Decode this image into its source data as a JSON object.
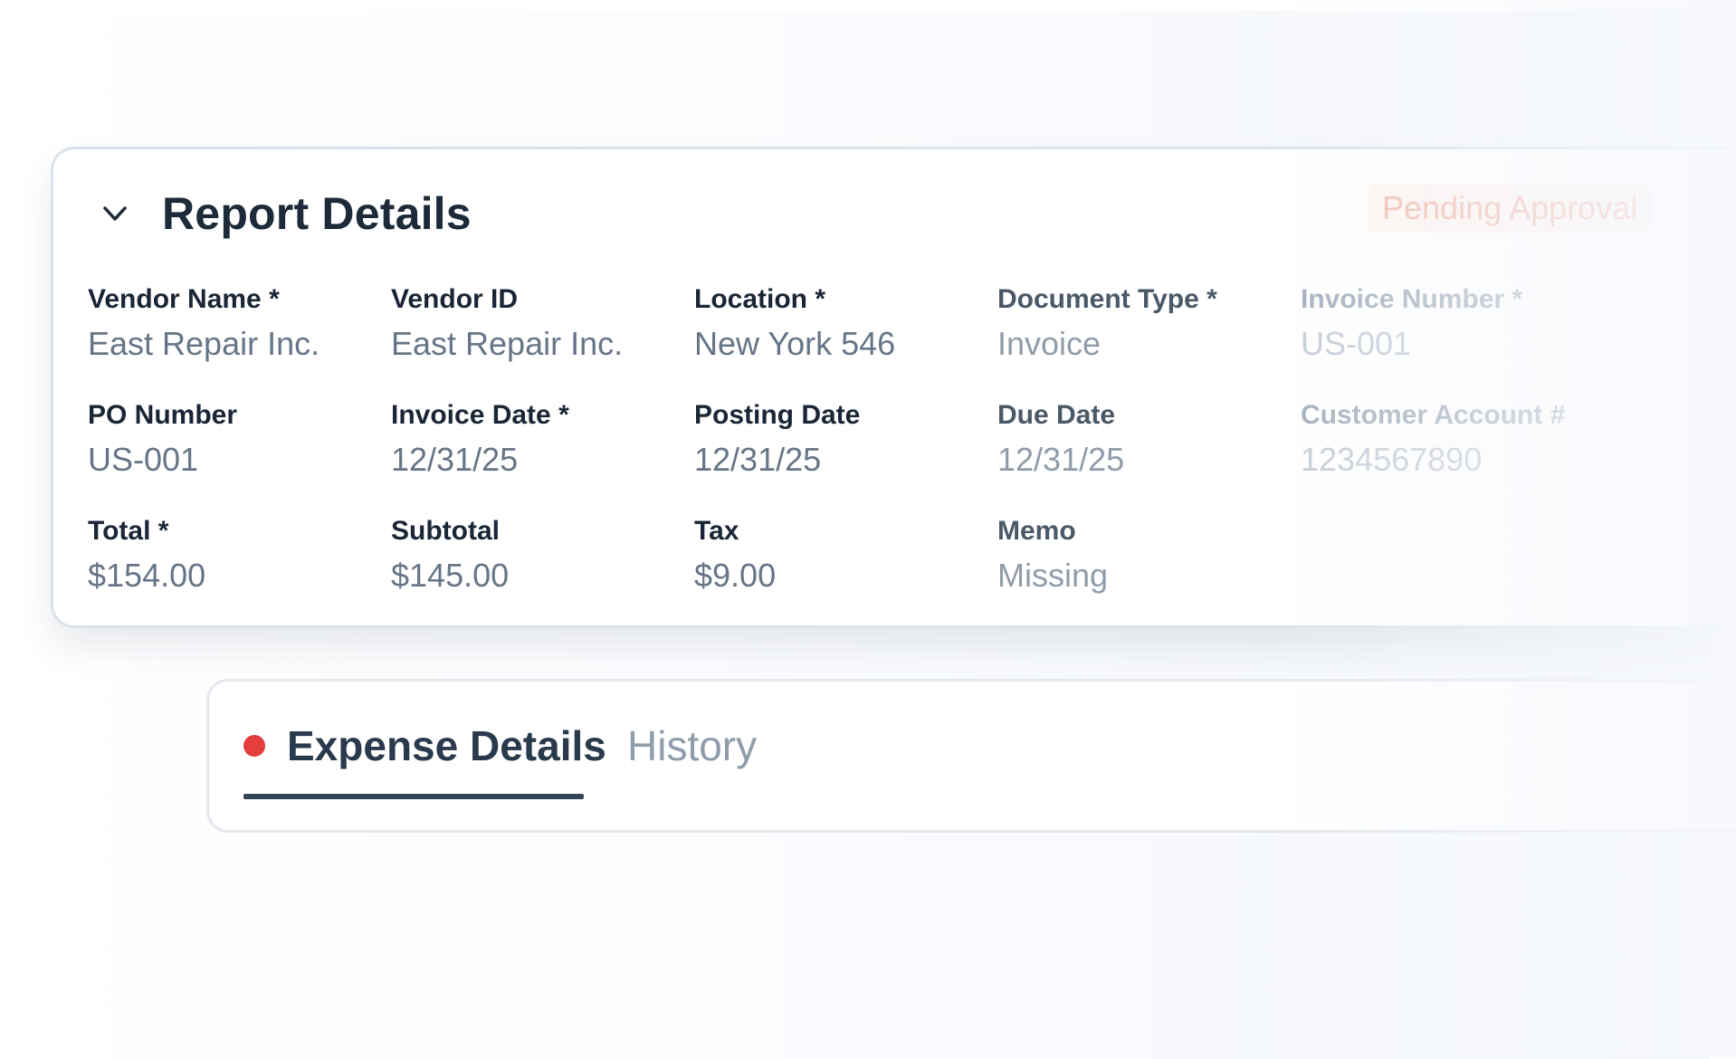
{
  "report": {
    "title": "Report Details",
    "status": "Pending Approval",
    "fields": [
      {
        "label": "Vendor Name *",
        "value": "East Repair Inc."
      },
      {
        "label": "Vendor ID",
        "value": "East Repair Inc."
      },
      {
        "label": "Location *",
        "value": "New York 546"
      },
      {
        "label": "Document Type *",
        "value": "Invoice"
      },
      {
        "label": "Invoice Number *",
        "value": "US-001"
      },
      {
        "label": "PO Number",
        "value": "US-001"
      },
      {
        "label": "Invoice Date *",
        "value": "12/31/25"
      },
      {
        "label": "Posting Date",
        "value": "12/31/25"
      },
      {
        "label": "Due Date",
        "value": "12/31/25"
      },
      {
        "label": "Customer Account #",
        "value": "1234567890"
      },
      {
        "label": "Total *",
        "value": "$154.00"
      },
      {
        "label": "Subtotal",
        "value": "$145.00"
      },
      {
        "label": "Tax",
        "value": "$9.00"
      },
      {
        "label": "Memo",
        "value": "Missing"
      }
    ]
  },
  "tabs": [
    {
      "label": "Expense Details",
      "active": true,
      "alert": true
    },
    {
      "label": "History",
      "active": false,
      "alert": false
    }
  ],
  "colors": {
    "title": "#1d2a3a",
    "alert_dot": "#e53e3e",
    "status_text": "#f1b9a9",
    "underline": "#334455"
  },
  "icons": {
    "collapse": "chevron-down-icon",
    "alert": "red-dot-icon"
  }
}
